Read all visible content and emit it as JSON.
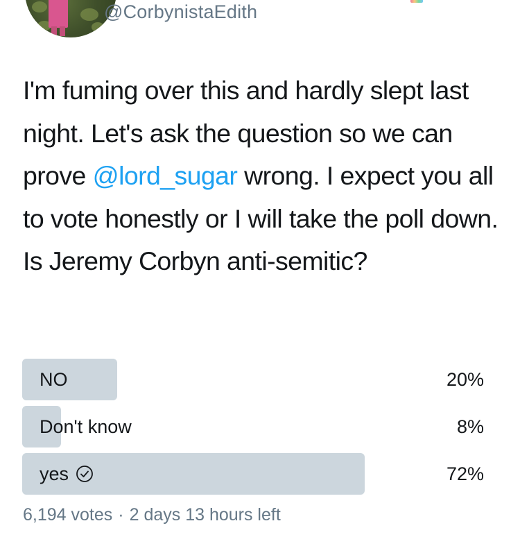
{
  "tweet": {
    "avatar_icon": "avatar",
    "handle": "@CorbynistaEdith",
    "text_parts": {
      "before_mention": "I'm fuming over this and hardly slept last night. Let's ask the question so we can prove ",
      "mention": "@lord_sugar",
      "after_mention": " wrong. I expect you all to vote honestly or I will take the poll down.",
      "question": "Is Jeremy Corbyn anti-semitic?"
    }
  },
  "poll": {
    "options": [
      {
        "label": "NO",
        "percent_text": "20%",
        "percent": 20,
        "selected": false
      },
      {
        "label": "Don't know",
        "percent_text": "8%",
        "percent": 8,
        "selected": false
      },
      {
        "label": "yes",
        "percent_text": "72%",
        "percent": 72,
        "selected": true
      }
    ],
    "votes": "6,194 votes",
    "separator": "·",
    "time_left": "2 days 13 hours left",
    "selected_icon": "check-circle-icon"
  },
  "colors": {
    "text": "#14171a",
    "secondary": "#657786",
    "mention": "#1da1f2",
    "bar": "#ccd6dd"
  }
}
